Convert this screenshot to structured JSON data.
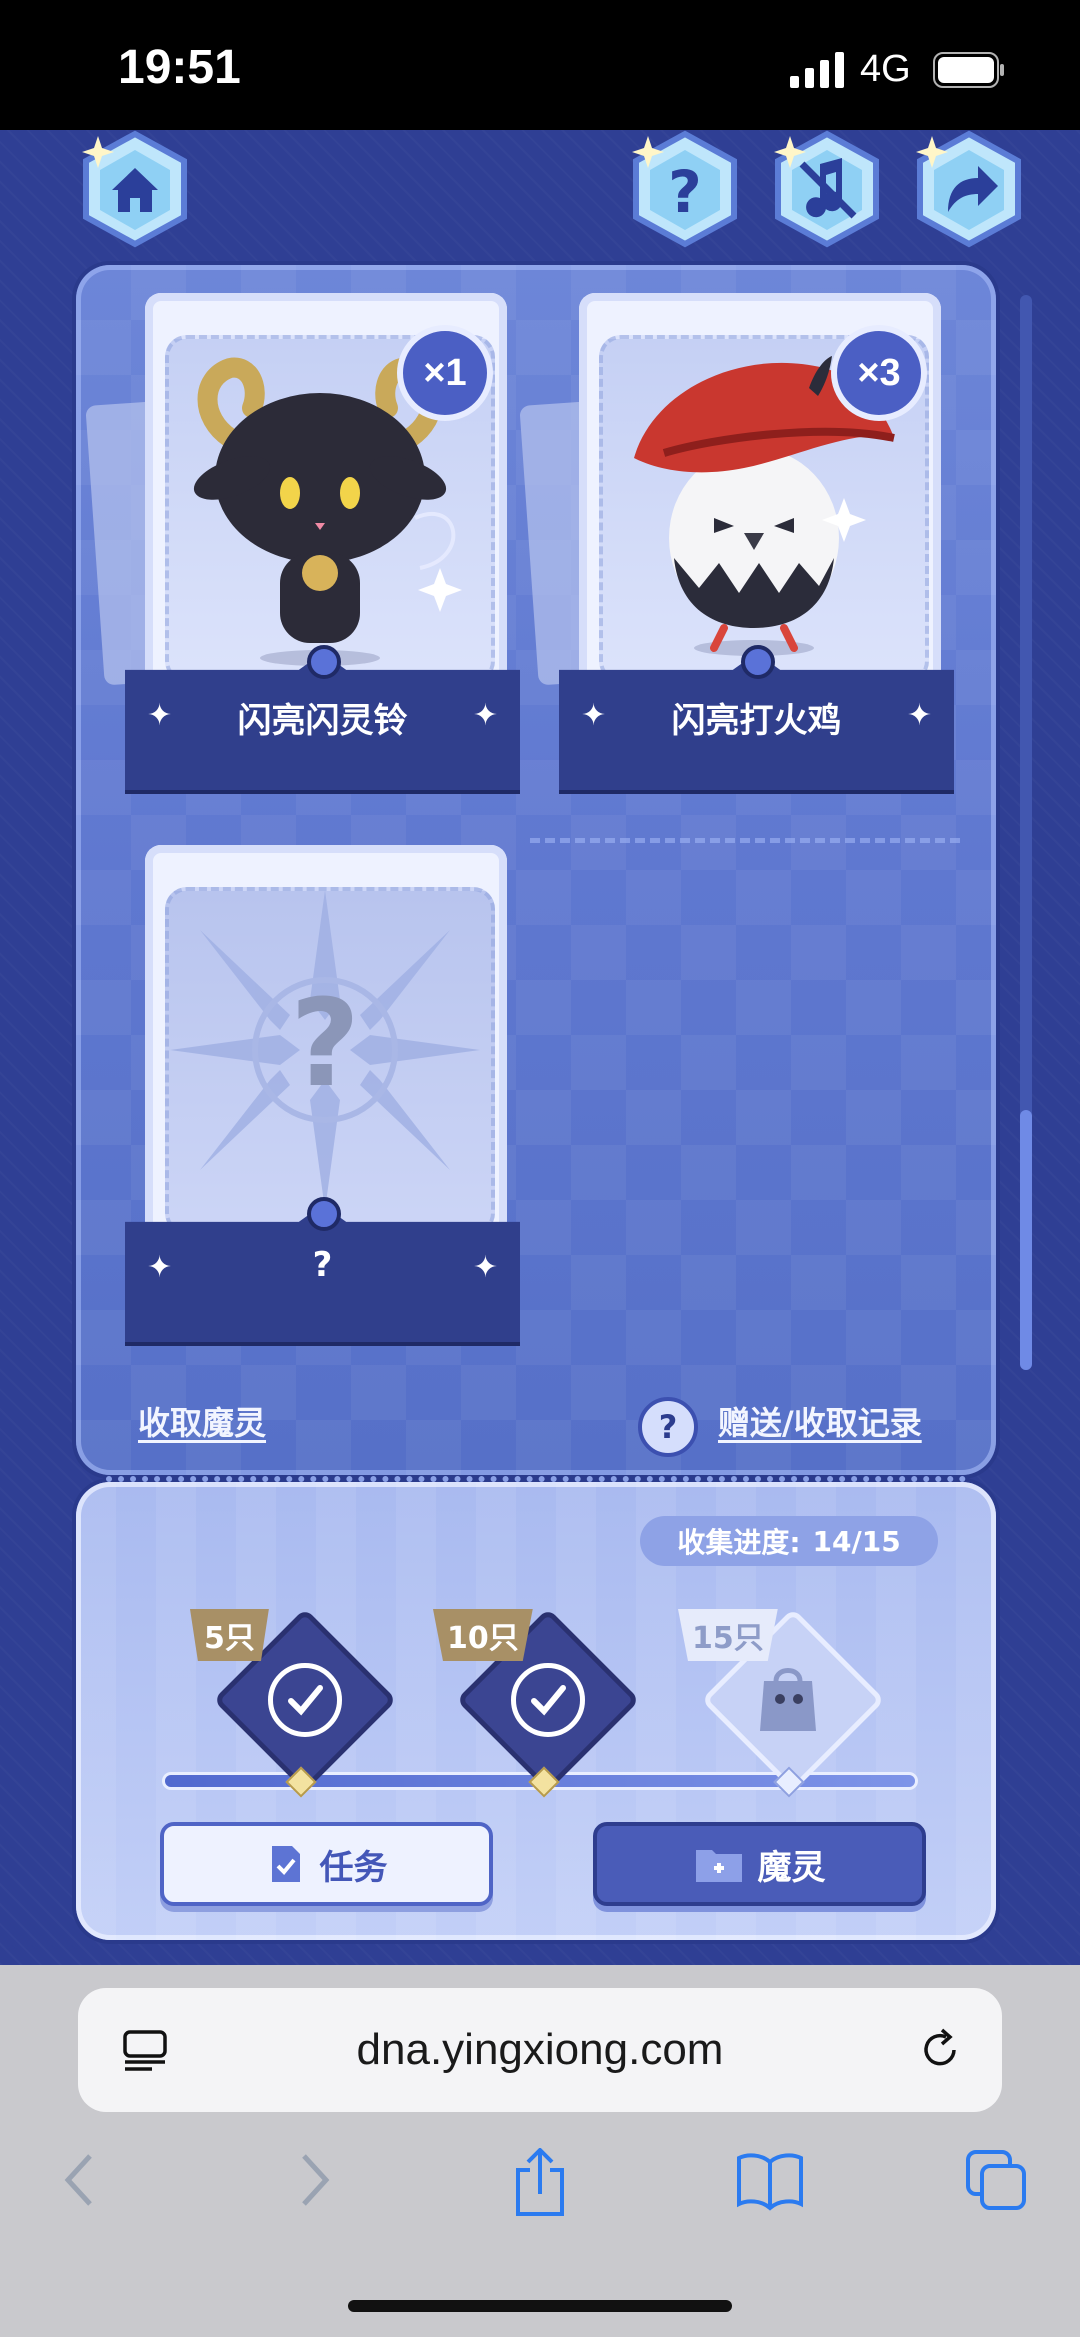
{
  "status_bar": {
    "time": "19:51",
    "network": "4G"
  },
  "header_buttons": [
    "home-icon",
    "help-icon",
    "mute-icon",
    "share-icon"
  ],
  "cards": [
    {
      "name": "闪亮闪灵铃",
      "count": "×1"
    },
    {
      "name": "闪亮打火鸡",
      "count": "×3"
    },
    {
      "name": "?",
      "count": ""
    }
  ],
  "locked_mark": "?",
  "links": {
    "collect": "收取魔灵",
    "records": "赠送/收取记录",
    "help_mark": "?"
  },
  "progress": {
    "label": "收集进度:",
    "value": "14/15",
    "current": 14,
    "total": 15
  },
  "milestones": [
    {
      "label": "5只",
      "done": true
    },
    {
      "label": "10只",
      "done": true
    },
    {
      "label": "15只",
      "done": false
    }
  ],
  "buttons": {
    "task": "任务",
    "spirit": "魔灵"
  },
  "browser": {
    "url": "dna.yingxiong.com"
  },
  "colors": {
    "panel": "#6d86d8",
    "dark_plate": "#303f8c",
    "accent": "#4a5cb8"
  }
}
